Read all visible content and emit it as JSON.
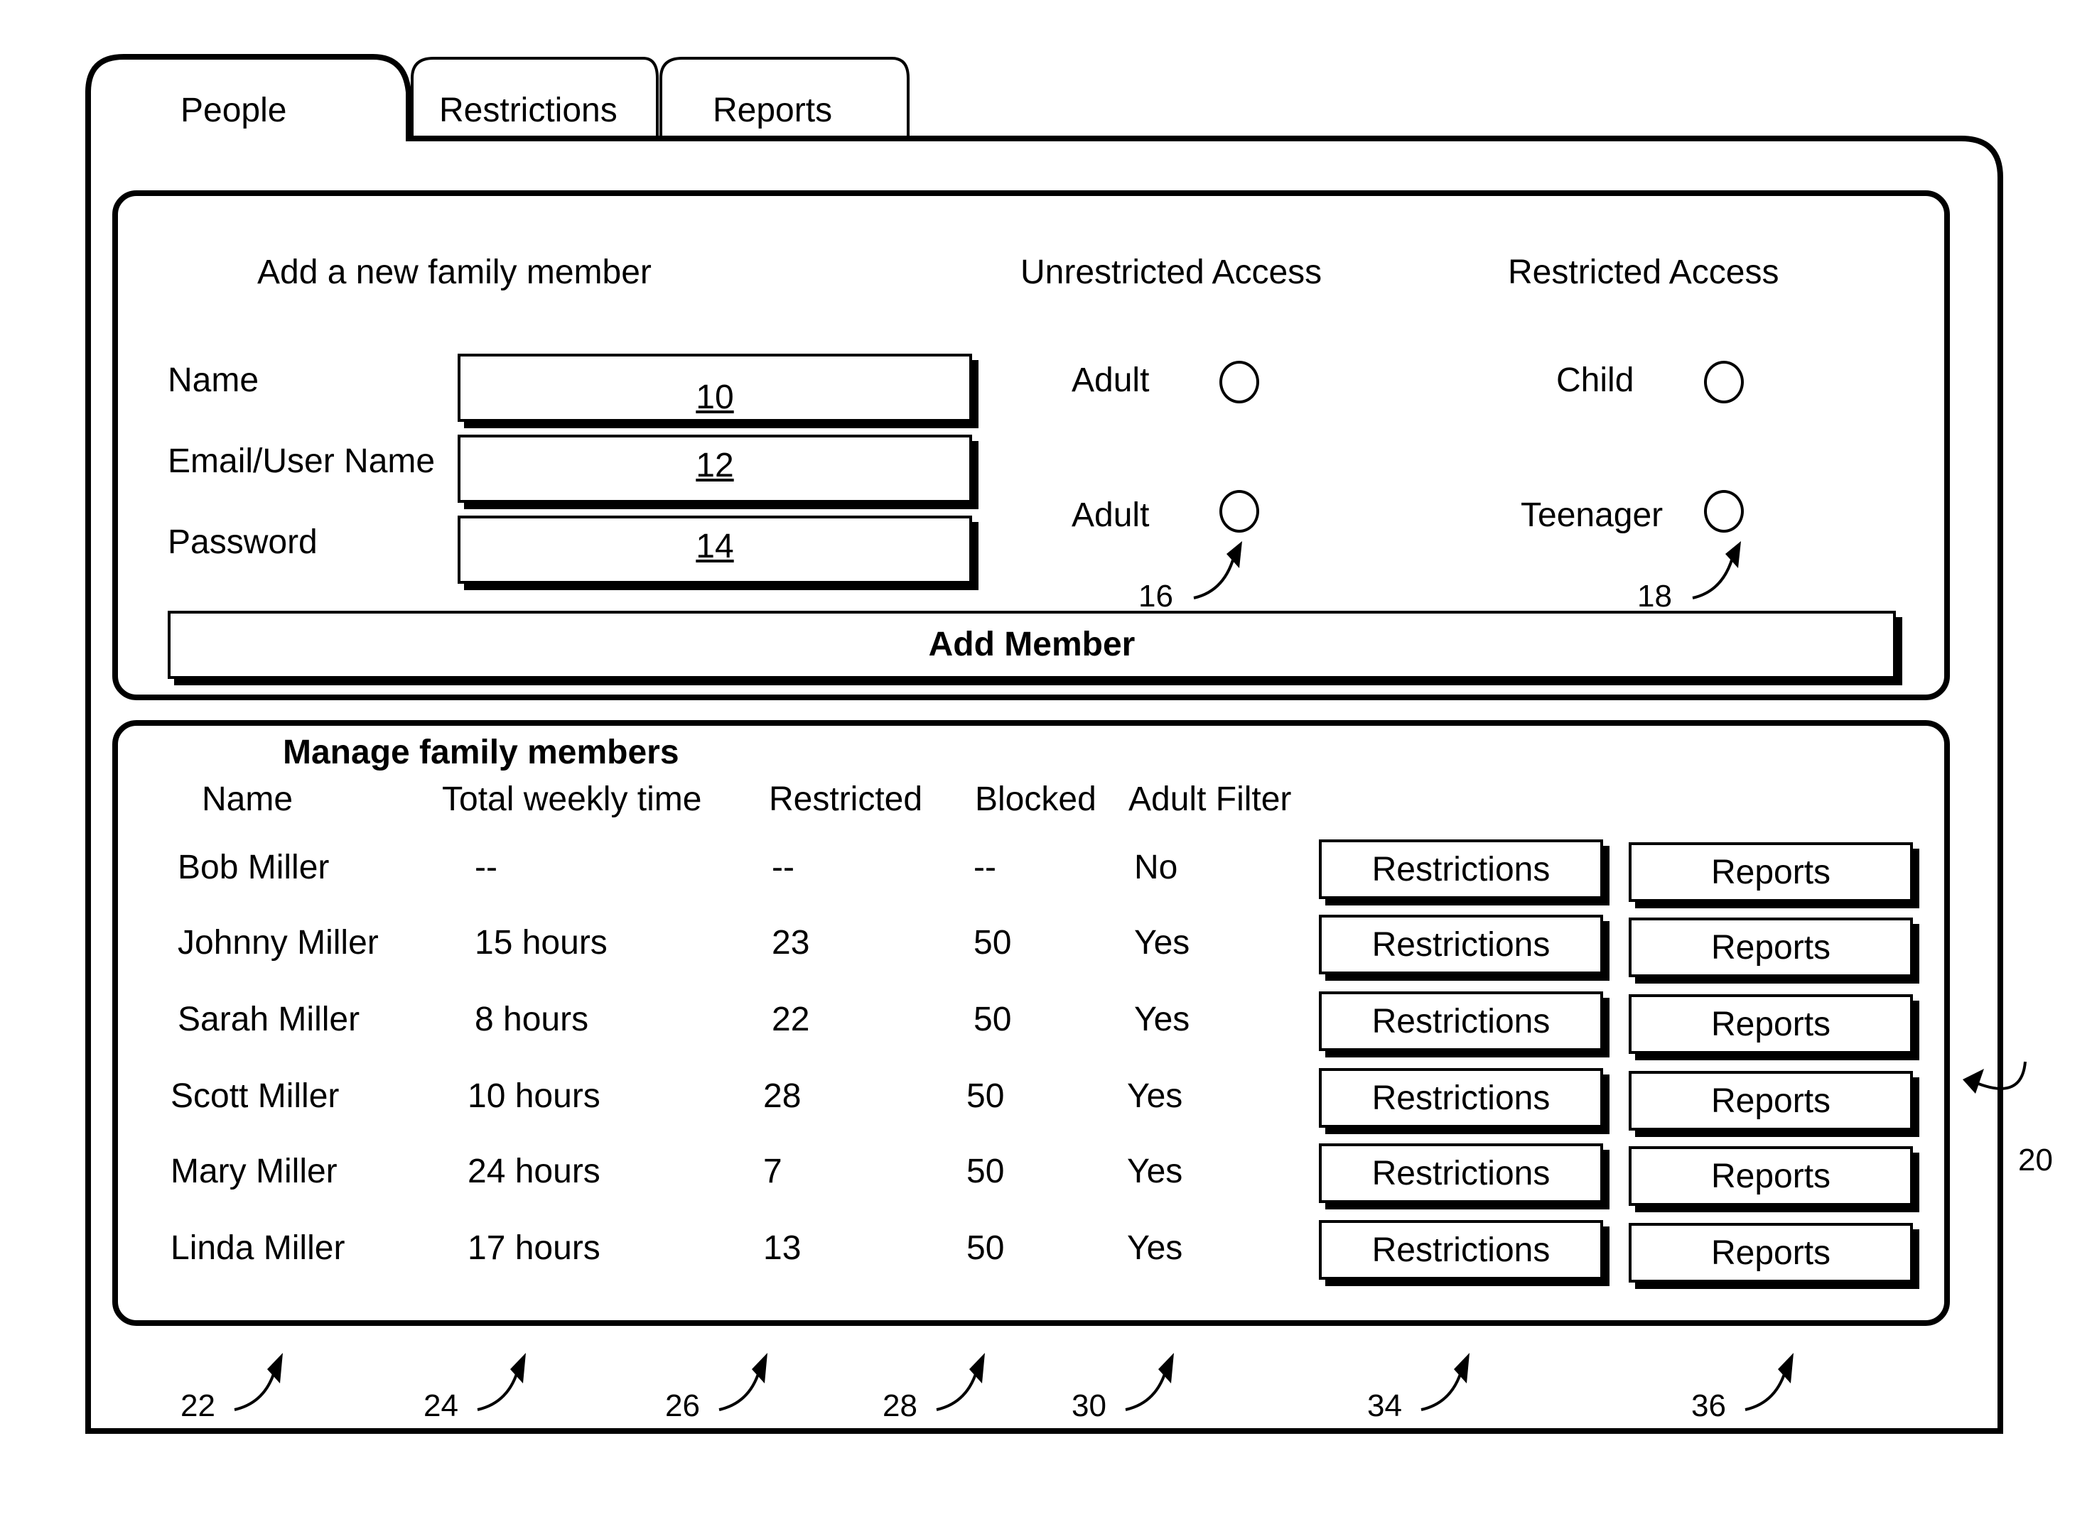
{
  "tabs": [
    {
      "label": "People",
      "active": true
    },
    {
      "label": "Restrictions",
      "active": false
    },
    {
      "label": "Reports",
      "active": false
    }
  ],
  "add_member": {
    "title": "Add a new family member",
    "fields": [
      {
        "label": "Name",
        "ref": "10"
      },
      {
        "label": "Email/User Name",
        "ref": "12"
      },
      {
        "label": "Password",
        "ref": "14"
      }
    ],
    "unrestricted": {
      "title": "Unrestricted Access",
      "options": [
        "Adult",
        "Adult"
      ],
      "ref": "16"
    },
    "restricted": {
      "title": "Restricted Access",
      "options": [
        "Child",
        "Teenager"
      ],
      "ref": "18"
    },
    "button": "Add Member"
  },
  "manage": {
    "title": "Manage family members",
    "headers": [
      "Name",
      "Total weekly time",
      "Restricted",
      "Blocked",
      "Adult Filter"
    ],
    "rows": [
      {
        "name": "Bob Miller",
        "time": "--",
        "restricted": "--",
        "blocked": "--",
        "filter": "No"
      },
      {
        "name": "Johnny Miller",
        "time": "15 hours",
        "restricted": "23",
        "blocked": "50",
        "filter": "Yes"
      },
      {
        "name": "Sarah Miller",
        "time": "8 hours",
        "restricted": "22",
        "blocked": "50",
        "filter": "Yes"
      },
      {
        "name": "Scott Miller",
        "time": "10 hours",
        "restricted": "28",
        "blocked": "50",
        "filter": "Yes"
      },
      {
        "name": "Mary Miller",
        "time": "24 hours",
        "restricted": "7",
        "blocked": "50",
        "filter": "Yes"
      },
      {
        "name": "Linda Miller",
        "time": "17 hours",
        "restricted": "13",
        "blocked": "50",
        "filter": "Yes"
      }
    ],
    "restrictions_label": "Restrictions",
    "reports_label": "Reports"
  },
  "refs": {
    "panel": "20",
    "cols": [
      "22",
      "24",
      "26",
      "28",
      "30",
      "34",
      "36"
    ]
  }
}
